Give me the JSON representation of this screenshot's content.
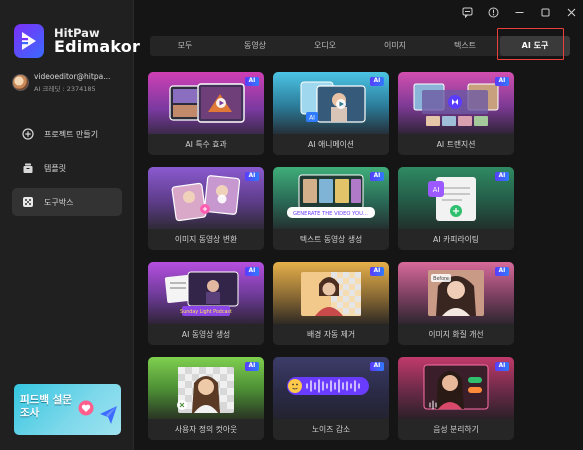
{
  "app": {
    "logo_line1": "HitPaw",
    "logo_line2": "Edimakor"
  },
  "user": {
    "email": "videoeditor@hitpa...",
    "credits": "AI 크레딧 : 2374185"
  },
  "sidebar": {
    "items": [
      {
        "label": "프로젝트 만들기",
        "icon": "plus-circle-icon"
      },
      {
        "label": "템플릿",
        "icon": "template-icon"
      },
      {
        "label": "도구박스",
        "icon": "toolbox-dice-icon"
      }
    ],
    "active_index": 2
  },
  "promo": {
    "text": "피드백 설문조사"
  },
  "titlebar": {
    "icons": [
      "feedback-icon",
      "info-icon",
      "minimize-icon",
      "maximize-icon",
      "close-icon"
    ]
  },
  "tabs": [
    "모두",
    "동영상",
    "오디오",
    "이미지",
    "텍스트",
    "AI 도구"
  ],
  "active_tab": 5,
  "badge_label": "AI",
  "thumb_texts": {
    "ai_chip": "AI",
    "generate_prompt": "GENERATE THE VIDEO YOU...",
    "podcast": "Sunday Light Podcast",
    "before": "Before"
  },
  "tools": [
    {
      "label": "AI 특수 효과"
    },
    {
      "label": "AI 애니메이션"
    },
    {
      "label": "AI 트랜지션"
    },
    {
      "label": "이미지 동영상 변환"
    },
    {
      "label": "텍스트 동영상 생성"
    },
    {
      "label": "AI 카피라이팅"
    },
    {
      "label": "AI 동영상 생성"
    },
    {
      "label": "배경 자동 제거"
    },
    {
      "label": "이미지 화질 개선"
    },
    {
      "label": "사용자 정의 컷아웃"
    },
    {
      "label": "노이즈 감소"
    },
    {
      "label": "음성 분리하기"
    }
  ],
  "colors": {
    "accent": "#6a3cff",
    "highlight_border": "#e8403a",
    "background": "#151515",
    "sidebar": "#202020"
  }
}
